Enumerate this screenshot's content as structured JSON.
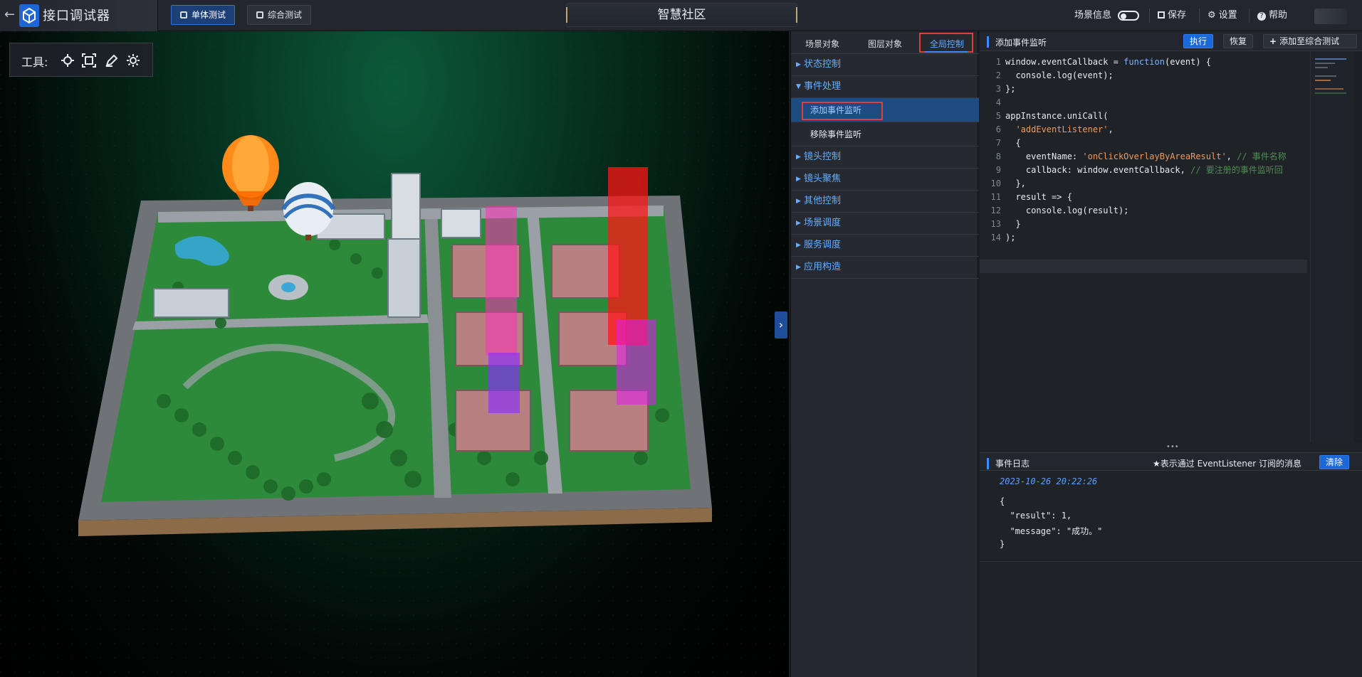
{
  "topbar": {
    "app_title": "接口调试器",
    "tabs": [
      {
        "label": "单体测试",
        "active": true
      },
      {
        "label": "综合测试",
        "active": false
      }
    ],
    "center_title": "智慧社区",
    "right": {
      "scene_info": "场景信息",
      "save": "保存",
      "settings": "设置",
      "help": "帮助"
    }
  },
  "scene": {
    "toolbox_label": "工具:",
    "tool_icons": [
      "locate-icon",
      "frame-icon",
      "pen-icon",
      "gear-icon"
    ]
  },
  "middle": {
    "tabs": [
      "场景对象",
      "图层对象",
      "全局控制"
    ],
    "active_tab": "全局控制",
    "tree": [
      {
        "label": "状态控制",
        "expanded": false
      },
      {
        "label": "事件处理",
        "expanded": true,
        "children": [
          "添加事件监听",
          "移除事件监听"
        ],
        "active_child": "添加事件监听"
      },
      {
        "label": "镜头控制",
        "expanded": false
      },
      {
        "label": "镜头聚焦",
        "expanded": false
      },
      {
        "label": "其他控制",
        "expanded": false
      },
      {
        "label": "场景调度",
        "expanded": false
      },
      {
        "label": "服务调度",
        "expanded": false
      },
      {
        "label": "应用构造",
        "expanded": false
      }
    ]
  },
  "right": {
    "header_title": "添加事件监听",
    "run": "执行",
    "restore": "恢复",
    "add_to_combo": "添加至综合测试",
    "code_lines": [
      "window.eventCallback = function(event) {",
      "  console.log(event);",
      "};",
      "",
      "appInstance.uniCall(",
      "  'addEventListener',",
      "  {",
      "    eventName: 'onClickOverlayByAreaResult', // 事件名称",
      "    callback: window.eventCallback, // 要注册的事件监听回",
      "  },",
      "  result => {",
      "    console.log(result);",
      "  }",
      ");"
    ],
    "log": {
      "title": "事件日志",
      "note": "★表示通过 EventListener 订阅的消息",
      "clear": "清除",
      "timestamp": "2023-10-26 20:22:26",
      "lines": [
        "{",
        "  \"result\": 1,",
        "  \"message\": \"成功。\"",
        "}"
      ]
    }
  },
  "colors": {
    "accent_blue": "#3b8cff",
    "highlight_red": "#e23c3c",
    "selected_bg": "#1e4c82"
  }
}
